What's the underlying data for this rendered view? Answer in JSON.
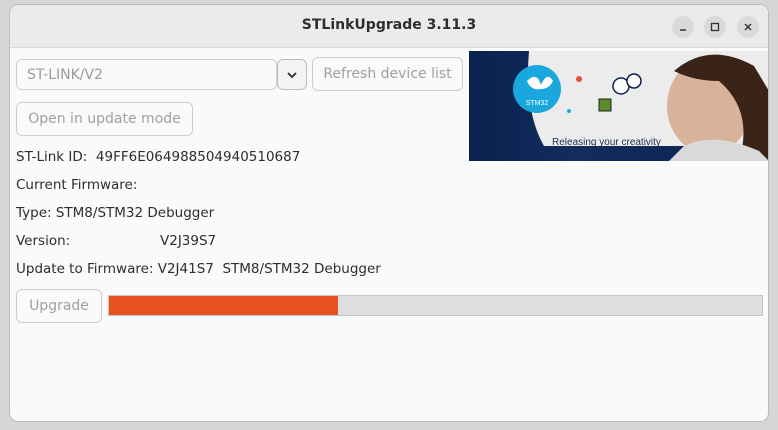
{
  "window": {
    "title": "STLinkUpgrade 3.11.3"
  },
  "device": {
    "selected": "ST-LINK/V2",
    "refresh_label": "Refresh device list",
    "open_update_label": "Open in update mode"
  },
  "info": {
    "stlink_id": "ST-Link ID:  49FF6E064988504940510687",
    "current_firmware": "Current Firmware:",
    "type": "Type: STM8/STM32 Debugger",
    "version_label": "Version:",
    "version_value": "V2J39S7",
    "update_to": "Update to Firmware: V2J41S7  STM8/STM32 Debugger"
  },
  "banner": {
    "logo_text": "STM32",
    "tagline": "Releasing your creativity"
  },
  "upgrade": {
    "button_label": "Upgrade",
    "progress_fraction": 0.35
  },
  "colors": {
    "accent": "#e8531f",
    "banner_bg": "#0a2250",
    "logo_blue": "#1aa7dd"
  }
}
